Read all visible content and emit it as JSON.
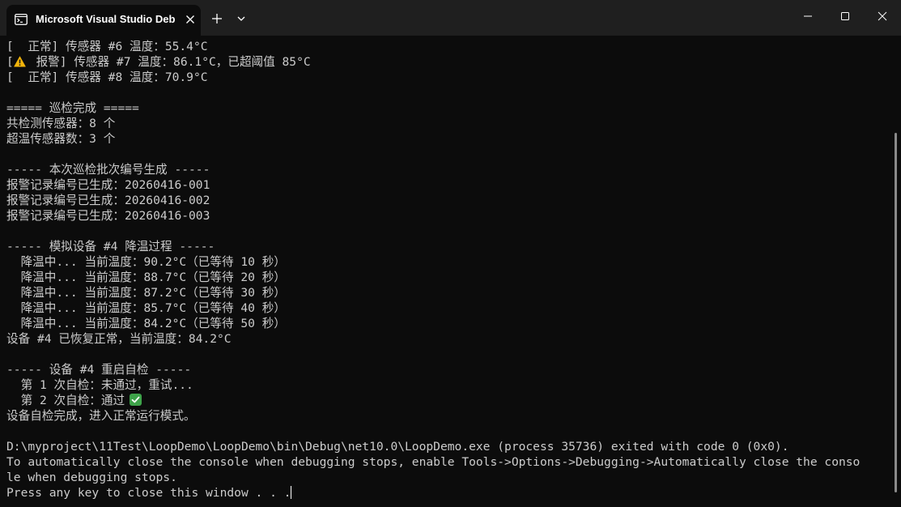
{
  "tab": {
    "title": "Microsoft Visual Studio Debug Console"
  },
  "icons": [
    "console-icon",
    "close-icon",
    "plus-icon",
    "chevron-down-icon",
    "minimize-icon",
    "maximize-icon",
    "close-window-icon",
    "warning-icon",
    "check-icon"
  ],
  "colors": {
    "background": "#0c0c0c",
    "titlebar": "#1f1f1f",
    "text": "#cccccc",
    "warning": "#f2b40b",
    "success": "#3ea34a"
  },
  "console": {
    "lines": [
      "[  正常] 传感器 #6 温度：55.4°C",
      "",
      "[  正常] 传感器 #8 温度：70.9°C",
      "",
      "===== 巡检完成 =====",
      "共检测传感器：8 个",
      "超温传感器数：3 个",
      "",
      "----- 本次巡检批次编号生成 -----",
      "报警记录编号已生成：20260416-001",
      "报警记录编号已生成：20260416-002",
      "报警记录编号已生成：20260416-003",
      "",
      "----- 模拟设备 #4 降温过程 -----",
      "  降温中... 当前温度：90.2°C（已等待 10 秒）",
      "  降温中... 当前温度：88.7°C（已等待 20 秒）",
      "  降温中... 当前温度：87.2°C（已等待 30 秒）",
      "  降温中... 当前温度：85.7°C（已等待 40 秒）",
      "  降温中... 当前温度：84.2°C（已等待 50 秒）",
      "设备 #4 已恢复正常，当前温度：84.2°C",
      "",
      "----- 设备 #4 重启自检 -----",
      "  第 1 次自检：未通过，重试...",
      "",
      "设备自检完成，进入正常运行模式。",
      "",
      "D:\\myproject\\11Test\\LoopDemo\\LoopDemo\\bin\\Debug\\net10.0\\LoopDemo.exe (process 35736) exited with code 0 (0x0).",
      "To automatically close the console when debugging stops, enable Tools->Options->Debugging->Automatically close the conso",
      "le when debugging stops.",
      ""
    ],
    "warning_line": {
      "prefix": "[",
      "text": " 报警] 传感器 #7 温度：86.1°C，已超阈值 85°C"
    },
    "pass_line": {
      "text": "  第 2 次自检：通过"
    },
    "prompt_line": "Press any key to close this window . . ."
  }
}
